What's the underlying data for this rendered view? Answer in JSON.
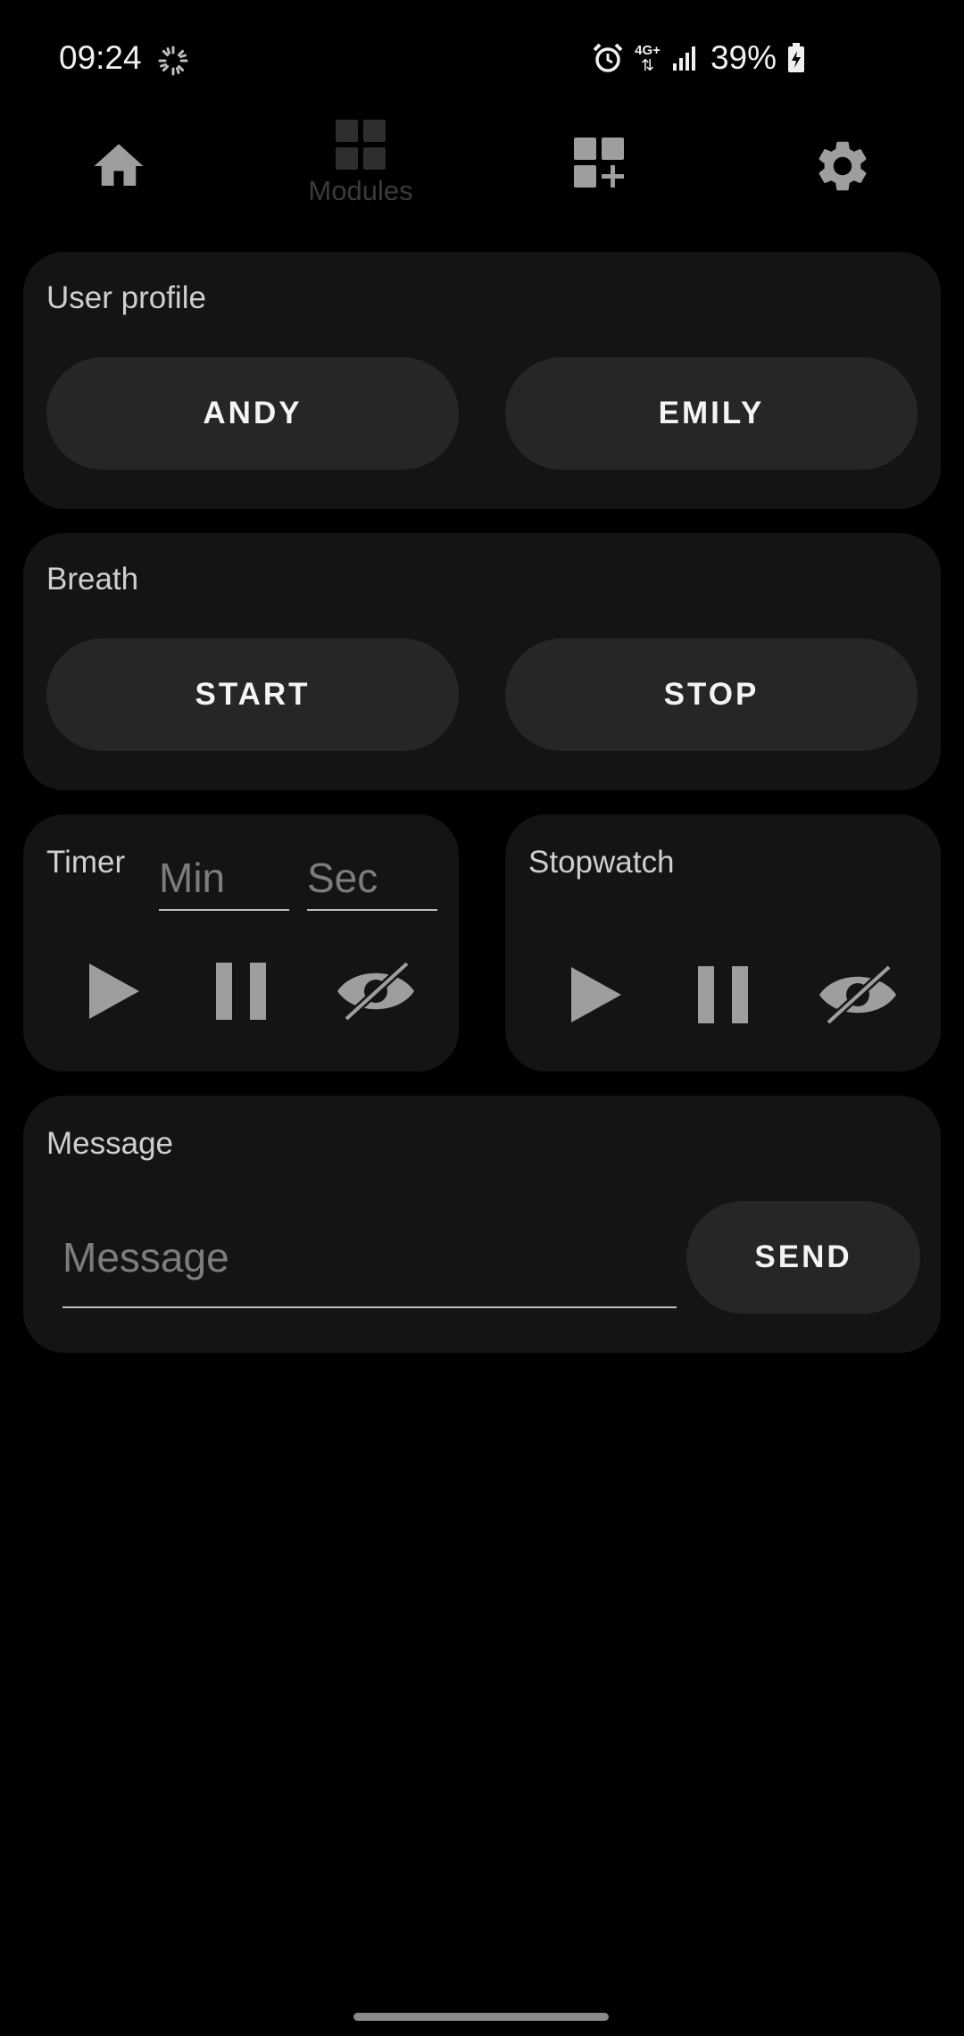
{
  "status_bar": {
    "time": "09:24",
    "network": "4G+",
    "battery_percent": "39%",
    "icons": [
      "sync-spinner-icon",
      "alarm-icon",
      "network-4g-icon",
      "signal-icon",
      "battery-charging-icon"
    ]
  },
  "top_nav": {
    "items": [
      {
        "name": "home",
        "icon": "home-icon",
        "label": ""
      },
      {
        "name": "modules",
        "icon": "grid-icon",
        "label": "Modules"
      },
      {
        "name": "add-module",
        "icon": "grid-add-icon",
        "label": ""
      },
      {
        "name": "settings",
        "icon": "gear-icon",
        "label": ""
      }
    ]
  },
  "user_profile": {
    "title": "User profile",
    "buttons": [
      "ANDY",
      "EMILY"
    ]
  },
  "breath": {
    "title": "Breath",
    "start_label": "START",
    "stop_label": "STOP"
  },
  "timer": {
    "title": "Timer",
    "min_placeholder": "Min",
    "sec_placeholder": "Sec",
    "controls": [
      "play-icon",
      "pause-icon",
      "visibility-off-icon"
    ]
  },
  "stopwatch": {
    "title": "Stopwatch",
    "controls": [
      "play-icon",
      "pause-icon",
      "visibility-off-icon"
    ]
  },
  "message": {
    "title": "Message",
    "placeholder": "Message",
    "send_label": "SEND"
  },
  "colors": {
    "background": "#000000",
    "card": "#141414",
    "button": "#262626",
    "icon": "#9e9e9e",
    "inactive_nav": "#3a3a3a"
  }
}
